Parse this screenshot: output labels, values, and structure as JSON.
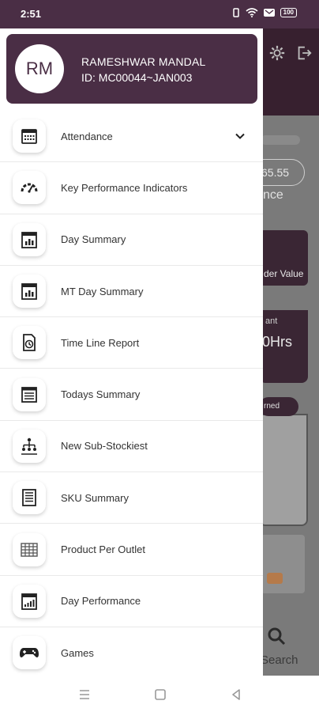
{
  "status_bar": {
    "time": "2:51",
    "battery": "100"
  },
  "profile": {
    "initials": "RM",
    "name": "RAMESHWAR MANDAL",
    "id": "ID: MC00044~JAN003"
  },
  "menu": [
    {
      "label": "Attendance",
      "icon": "calendar-icon"
    },
    {
      "label": "Key Performance Indicators",
      "icon": "gauge-icon"
    },
    {
      "label": "Day Summary",
      "icon": "chart-calendar-icon"
    },
    {
      "label": "MT Day Summary",
      "icon": "chart-calendar-icon"
    },
    {
      "label": "Time Line Report",
      "icon": "document-clock-icon"
    },
    {
      "label": "Todays Summary",
      "icon": "list-icon"
    },
    {
      "label": "New Sub-Stockiest",
      "icon": "hierarchy-icon"
    },
    {
      "label": "SKU Summary",
      "icon": "document-icon"
    },
    {
      "label": "Product Per Outlet",
      "icon": "grid-table-icon"
    },
    {
      "label": "Day Performance",
      "icon": "bar-chart-icon"
    },
    {
      "label": "Games",
      "icon": "gamepad-icon"
    }
  ],
  "background": {
    "pill_value": "65.55",
    "pill_sub": "nce",
    "card1_text": "der Value",
    "card2_label": "ant",
    "card2_value": "0Hrs",
    "badge_text": "rned",
    "search_label": "Search"
  },
  "colors": {
    "primary": "#4a2e45",
    "dark": "#37202f"
  }
}
